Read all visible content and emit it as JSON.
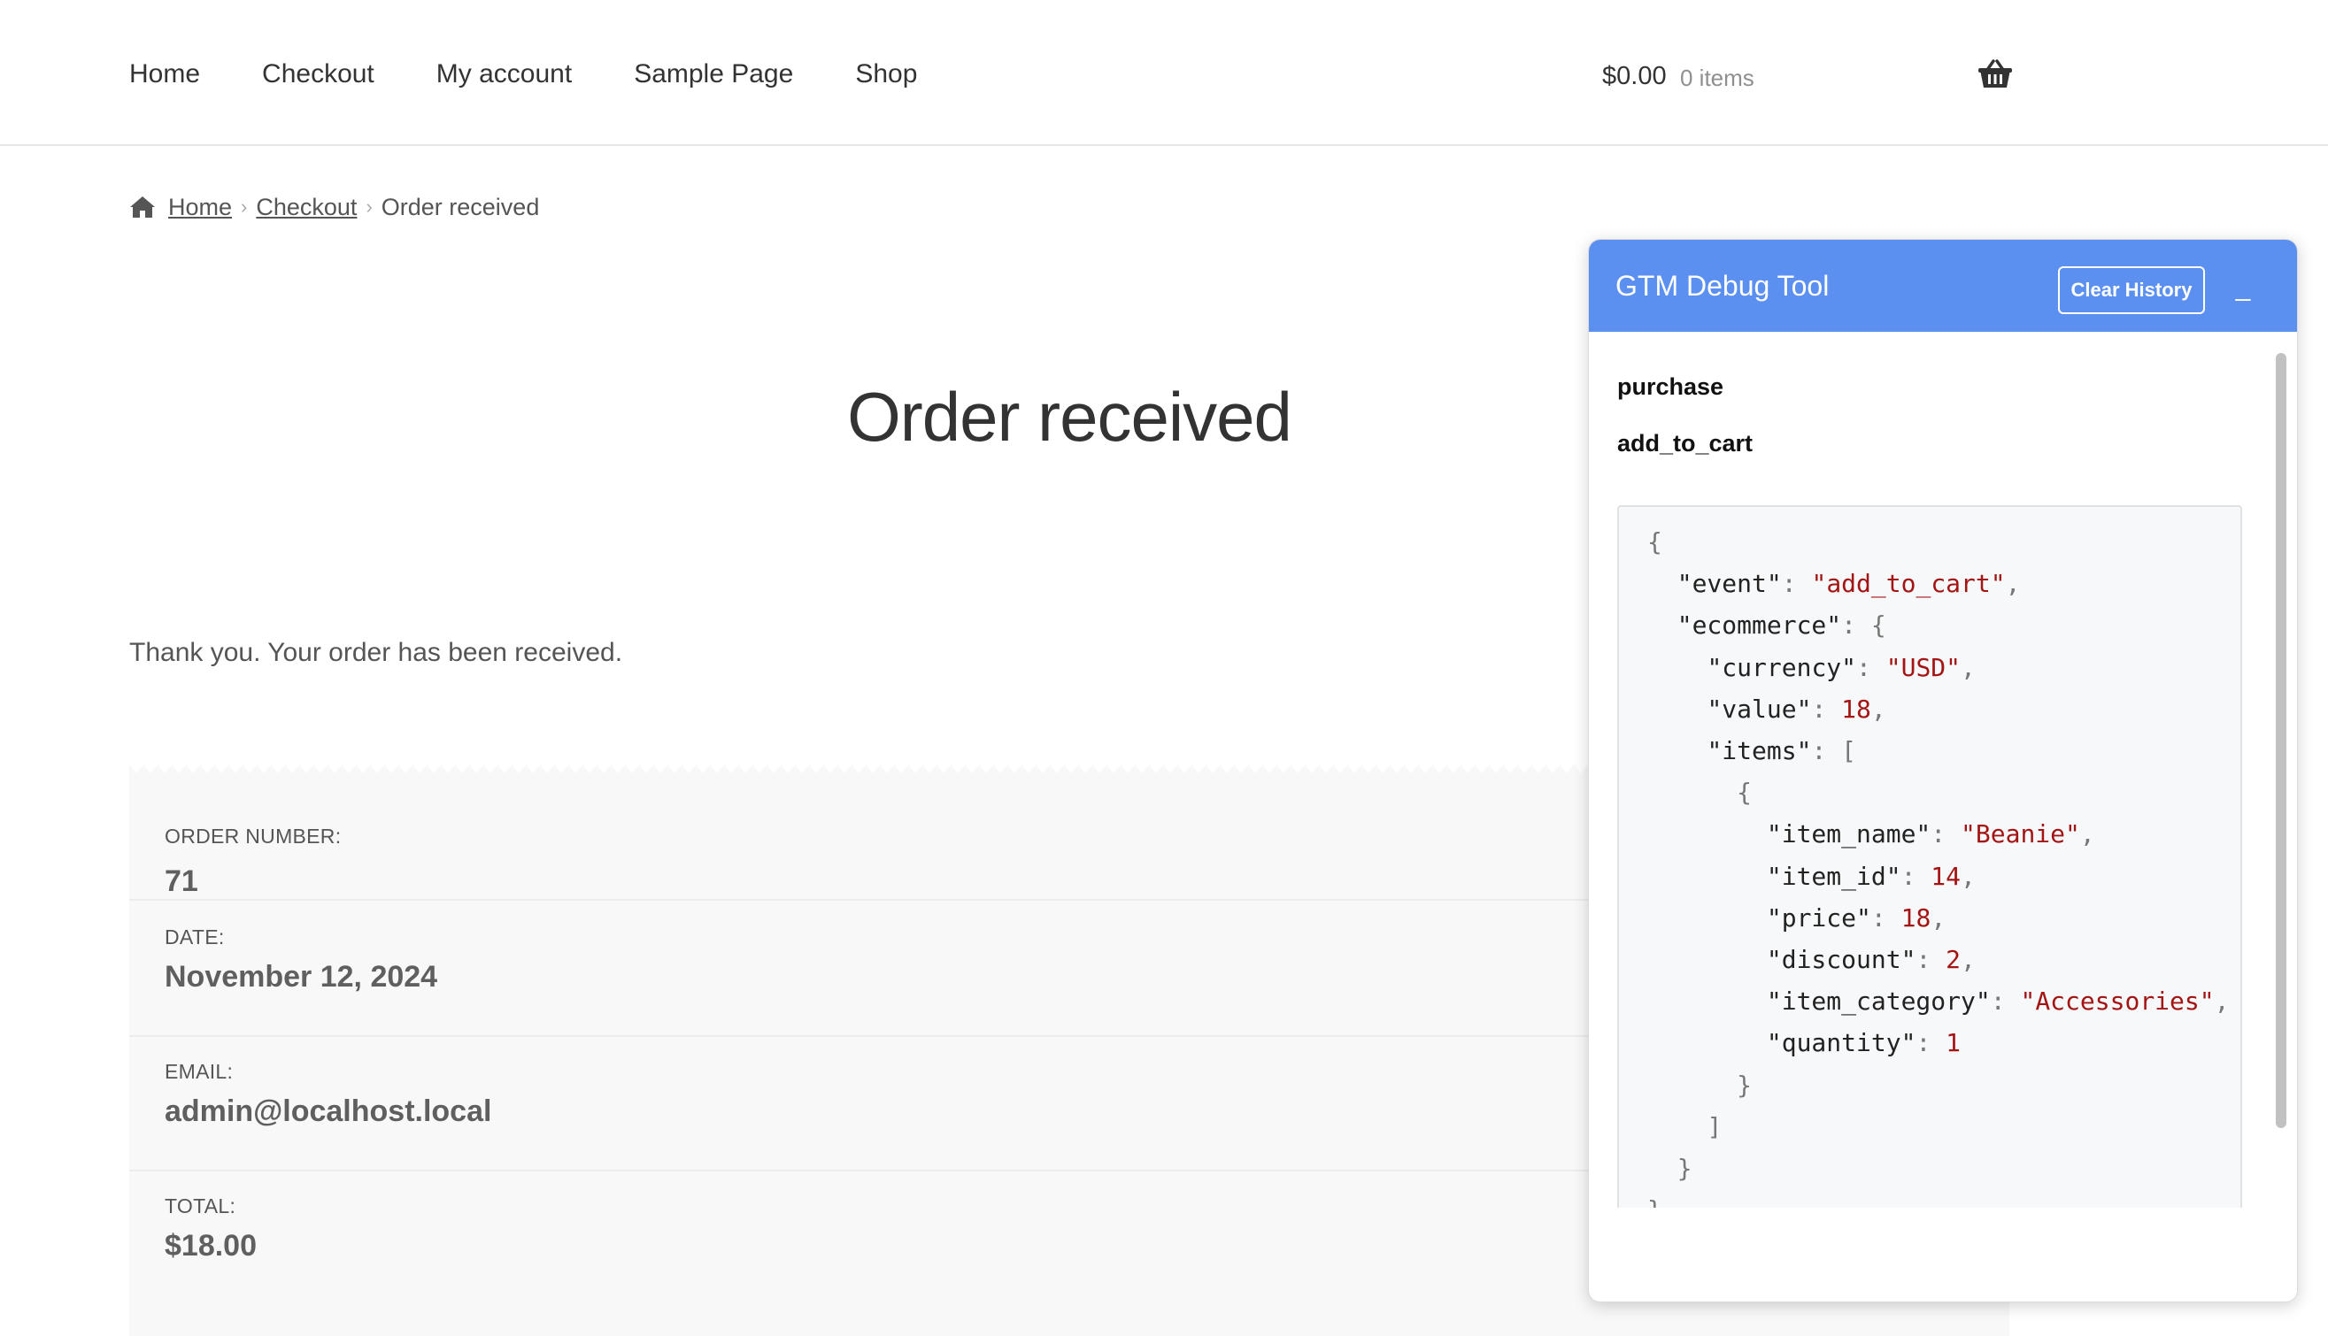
{
  "nav": {
    "items": [
      "Home",
      "Checkout",
      "My account",
      "Sample Page",
      "Shop"
    ]
  },
  "cart": {
    "total": "$0.00",
    "count": "0 items",
    "icon": "basket-icon"
  },
  "breadcrumb": {
    "home": "Home",
    "checkout": "Checkout",
    "current": "Order received",
    "separator": "›"
  },
  "page": {
    "title": "Order received",
    "thankyou": "Thank you. Your order has been received."
  },
  "order_overview": [
    {
      "label": "ORDER NUMBER:",
      "value": "71"
    },
    {
      "label": "DATE:",
      "value": "November 12, 2024"
    },
    {
      "label": "EMAIL:",
      "value": "admin@localhost.local"
    },
    {
      "label": "TOTAL:",
      "value": "$18.00"
    }
  ],
  "gtm": {
    "title": "GTM Debug Tool",
    "clear_label": "Clear History",
    "minimize_label": "_",
    "header_color": "#5b8ff0",
    "events": [
      "purchase",
      "add_to_cart"
    ],
    "payload": {
      "event": "add_to_cart",
      "currency": "USD",
      "value": "18",
      "item_name": "Beanie",
      "item_id": "14",
      "price": "18",
      "discount": "2",
      "item_category": "Accessories",
      "quantity": "1"
    }
  }
}
